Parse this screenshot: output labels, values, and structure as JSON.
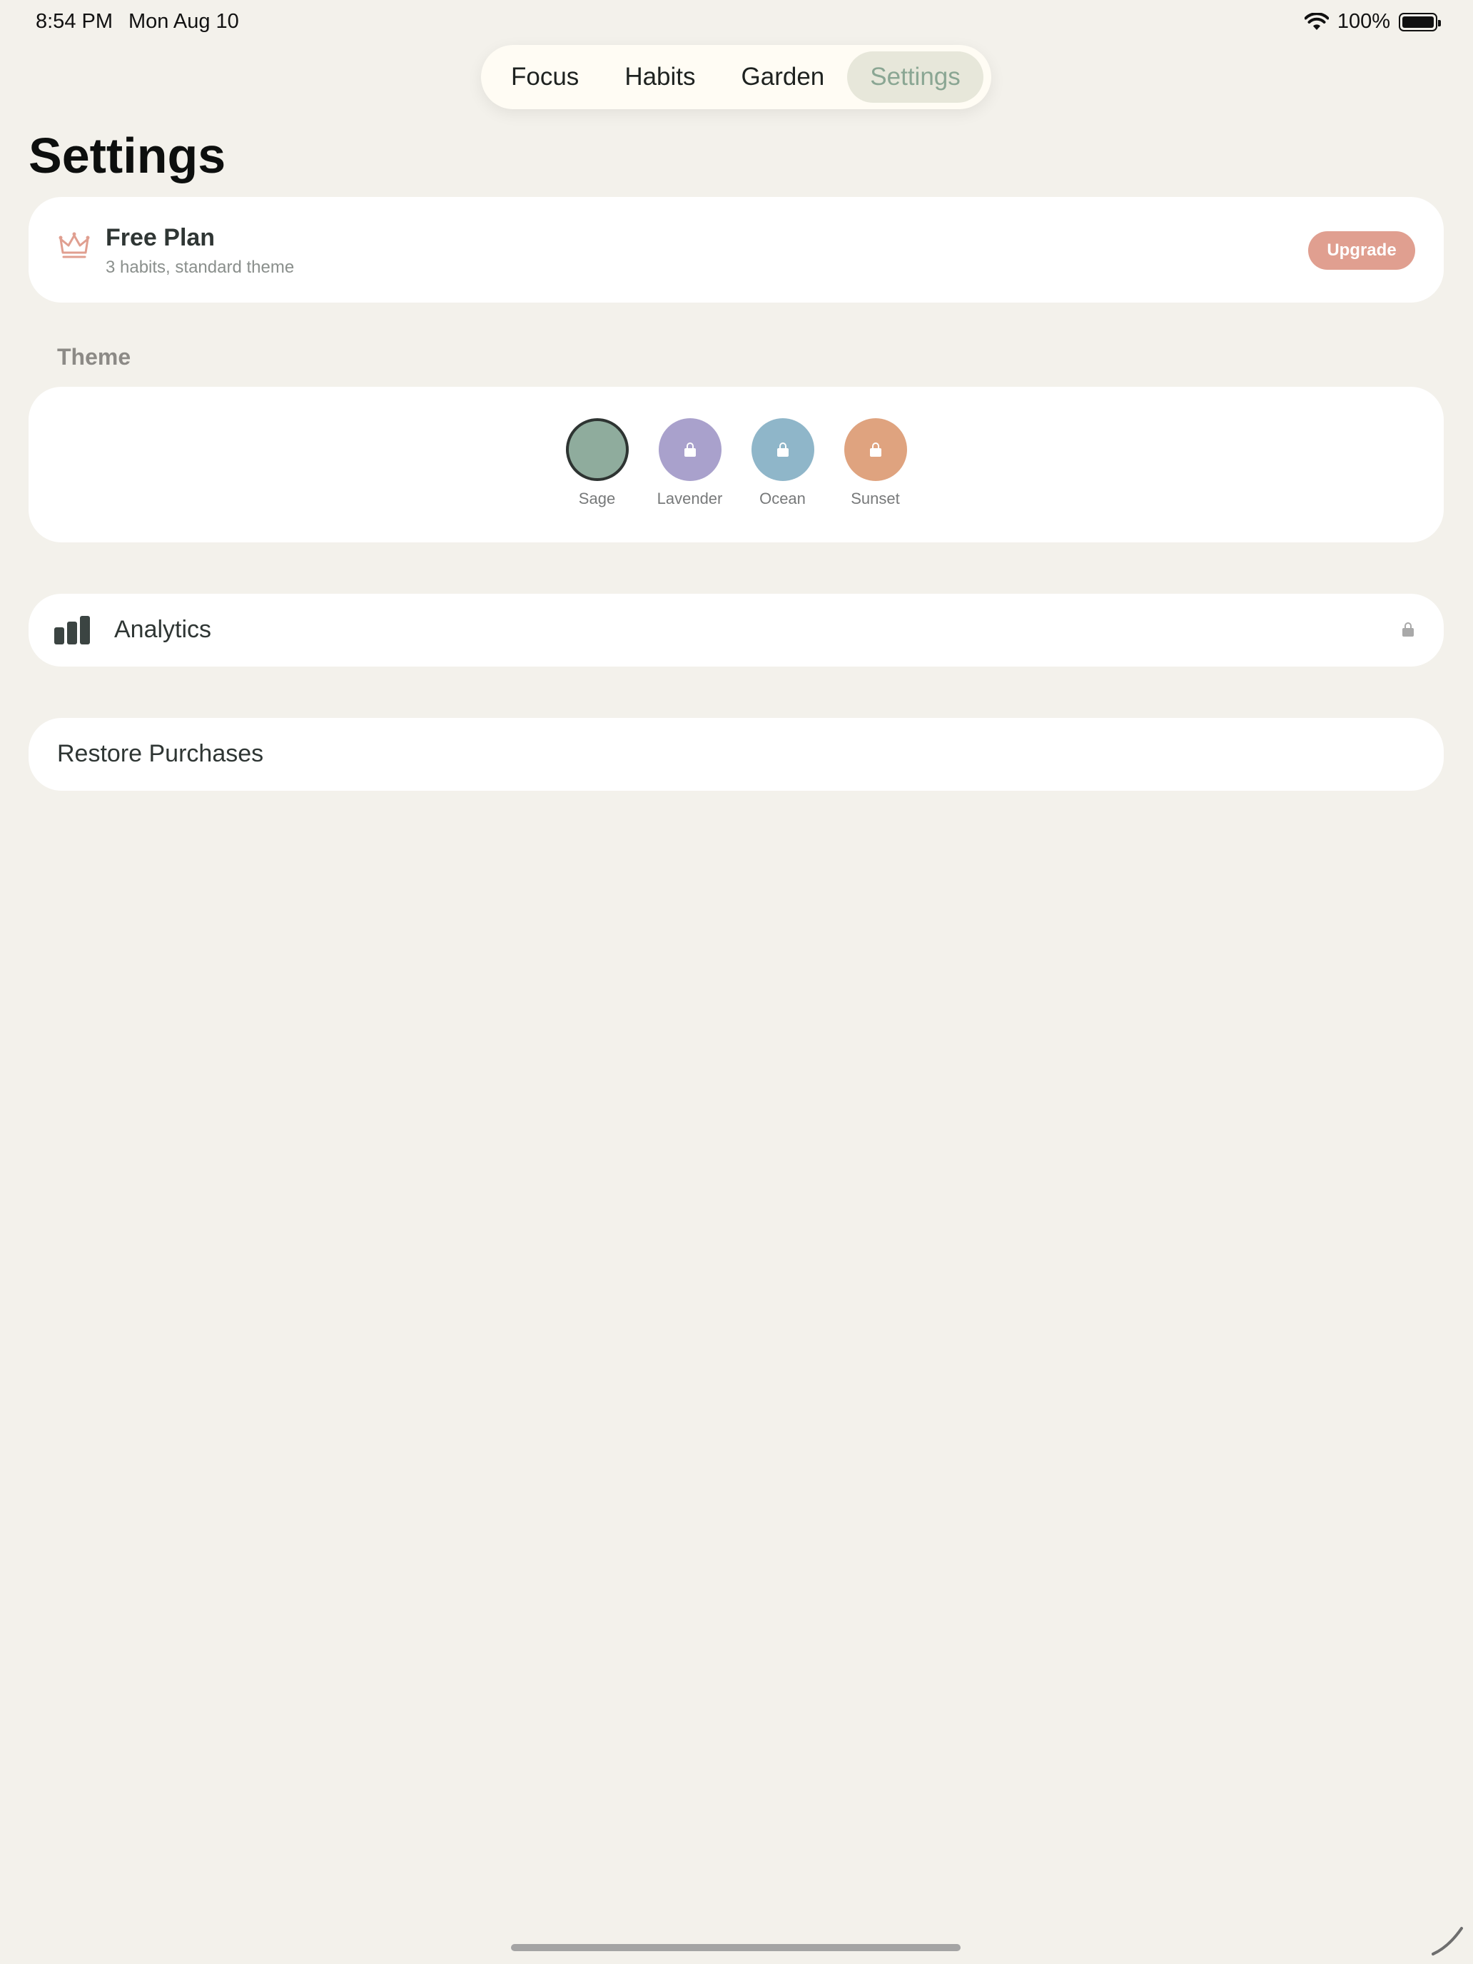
{
  "status_bar": {
    "time": "8:54 PM",
    "date": "Mon Aug 10",
    "battery": "100%"
  },
  "tabs": [
    {
      "label": "Focus",
      "active": false
    },
    {
      "label": "Habits",
      "active": false
    },
    {
      "label": "Garden",
      "active": false
    },
    {
      "label": "Settings",
      "active": true
    }
  ],
  "page": {
    "title": "Settings"
  },
  "plan": {
    "name": "Free Plan",
    "description": "3 habits, standard theme",
    "upgrade_label": "Upgrade",
    "icon": "crown-icon"
  },
  "theme": {
    "header": "Theme",
    "swatches": [
      {
        "label": "Sage",
        "color": "#8fac9d",
        "selected": true,
        "locked": false
      },
      {
        "label": "Lavender",
        "color": "#a9a1cc",
        "selected": false,
        "locked": true
      },
      {
        "label": "Ocean",
        "color": "#8fb6c9",
        "selected": false,
        "locked": true
      },
      {
        "label": "Sunset",
        "color": "#dfa37f",
        "selected": false,
        "locked": true
      }
    ]
  },
  "analytics": {
    "label": "Analytics",
    "locked": true,
    "icon": "bar-chart-icon"
  },
  "restore": {
    "label": "Restore Purchases"
  },
  "colors": {
    "background": "#f3f1eb",
    "accent": "#8aa693",
    "upgrade": "#e09f90"
  }
}
